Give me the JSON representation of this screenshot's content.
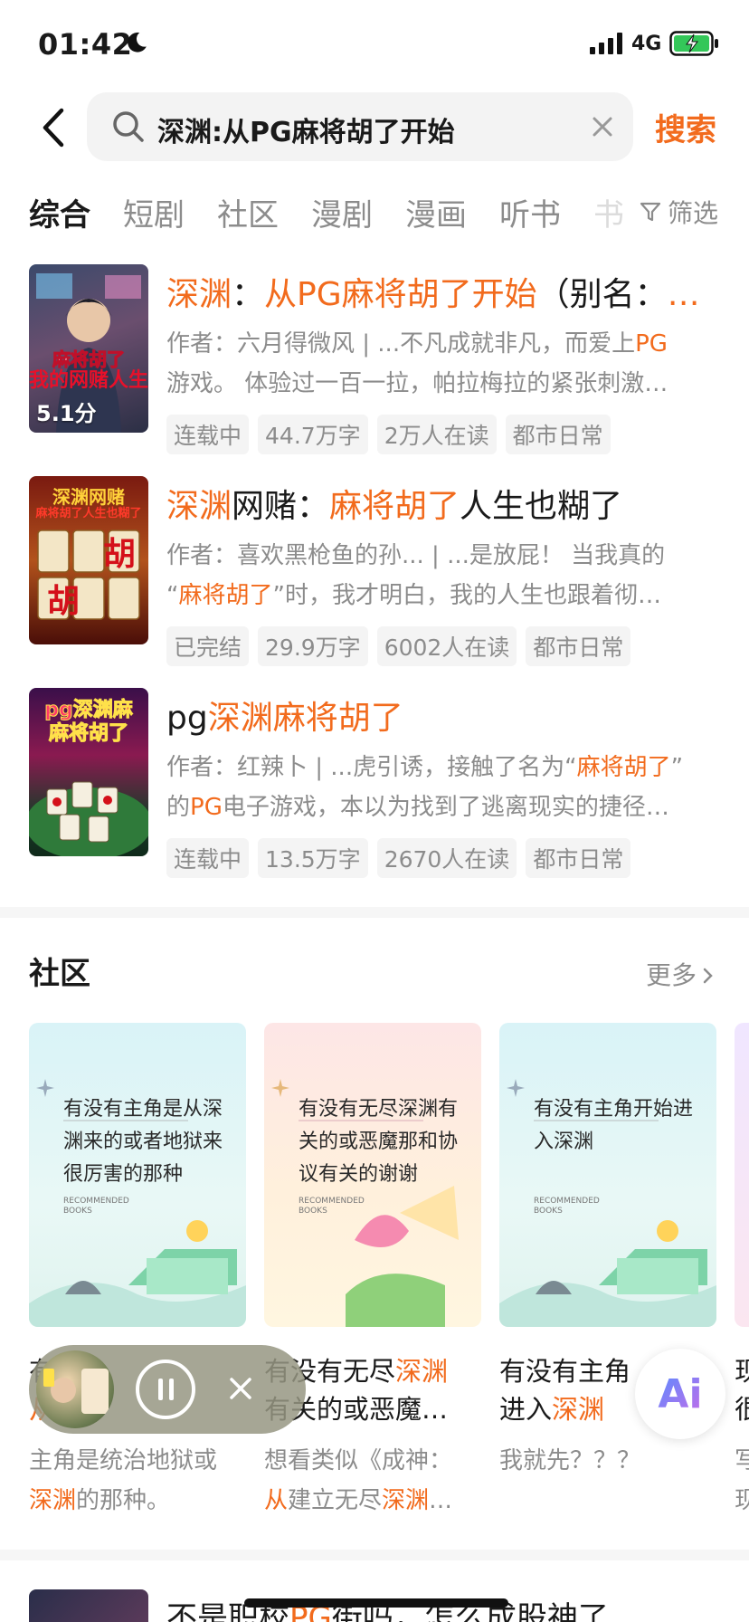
{
  "status_bar": {
    "time": "01:42",
    "network": "4G"
  },
  "search": {
    "query": "深渊:从PG麻将胡了开始",
    "button_label": "搜索"
  },
  "tabs": [
    "综合",
    "短剧",
    "社区",
    "漫剧",
    "漫画",
    "听书",
    "书"
  ],
  "filter_label": "筛选",
  "books": [
    {
      "title_parts": [
        {
          "text": "深渊",
          "hl": true
        },
        {
          "text": "：",
          "hl": false
        },
        {
          "text": "从PG麻将胡了开始",
          "hl": true
        },
        {
          "text": "（别名：",
          "hl": false
        },
        {
          "text": "…",
          "hl": true
        }
      ],
      "desc_lines": [
        [
          {
            "text": "作者：六月得微风 | ...不凡成就非凡，而爱上",
            "hl": false
          },
          {
            "text": "PG",
            "hl": true
          }
        ],
        [
          {
            "text": "游戏。 体验过一百一拉，帕拉梅拉的紧张刺激…",
            "hl": false
          }
        ]
      ],
      "tags": [
        "连载中",
        "44.7万字",
        "2万人在读",
        "都市日常"
      ],
      "cover_text": "麻将胡了\n我的网赌人生",
      "score": "5.1分"
    },
    {
      "title_parts": [
        {
          "text": "深渊",
          "hl": true
        },
        {
          "text": "网赌：",
          "hl": false
        },
        {
          "text": "麻将胡了",
          "hl": true
        },
        {
          "text": "人生也糊了",
          "hl": false
        }
      ],
      "desc_lines": [
        [
          {
            "text": "作者：喜欢黑枪鱼的孙... | ...是放屁！ 当我真的",
            "hl": false
          }
        ],
        [
          {
            "text": "“",
            "hl": false
          },
          {
            "text": "麻将胡了",
            "hl": true
          },
          {
            "text": "”时，我才明白，我的人生也跟着彻…",
            "hl": false
          }
        ]
      ],
      "tags": [
        "已完结",
        "29.9万字",
        "6002人在读",
        "都市日常"
      ],
      "cover_text": "深渊网赌\n麻将胡了人生也糊了",
      "score": ""
    },
    {
      "title_parts": [
        {
          "text": "pg",
          "hl": false
        },
        {
          "text": "深渊麻将胡了",
          "hl": true
        }
      ],
      "desc_lines": [
        [
          {
            "text": "作者：红辣卜 | ...虎引诱，接触了名为“",
            "hl": false
          },
          {
            "text": "麻将胡了",
            "hl": true
          },
          {
            "text": "”",
            "hl": false
          }
        ],
        [
          {
            "text": "的",
            "hl": false
          },
          {
            "text": "PG",
            "hl": true
          },
          {
            "text": "电子游戏，本以为找到了逃离现实的捷径…",
            "hl": false
          }
        ]
      ],
      "tags": [
        "连载中",
        "13.5万字",
        "2670人在读",
        "都市日常"
      ],
      "cover_text": "pg深渊麻\n麻将胡了",
      "score": ""
    }
  ],
  "community": {
    "title": "社区",
    "more_label": "更多",
    "cards": [
      {
        "image_text": "有没有主角是从深渊来的或者地狱来很厉害的那种",
        "rec_text": "RECOMMENDED\nBOOKS",
        "title_parts": [
          {
            "text": "有",
            "hl": false
          }
        ],
        "title_line2": [
          {
            "text": "从",
            "hl": true
          }
        ],
        "desc_parts": [
          {
            "text": "主角是统治地狱或",
            "hl": false
          }
        ],
        "desc_line2": [
          {
            "text": "深渊",
            "hl": true
          },
          {
            "text": "的那种。",
            "hl": false
          }
        ]
      },
      {
        "image_text": "有没有无尽深渊有关的或恶魔那和协议有关的谢谢",
        "rec_text": "RECOMMENDED\nBOOKS",
        "title_parts": [
          {
            "text": "有没有无尽",
            "hl": false
          },
          {
            "text": "深渊",
            "hl": true
          }
        ],
        "title_line2": [
          {
            "text": "有关的或恶魔…",
            "hl": false
          }
        ],
        "desc_parts": [
          {
            "text": "想看类似《成神：",
            "hl": false
          }
        ],
        "desc_line2": [
          {
            "text": "从",
            "hl": true
          },
          {
            "text": "建立无尽",
            "hl": false
          },
          {
            "text": "深渊",
            "hl": true
          },
          {
            "text": "…",
            "hl": false
          }
        ]
      },
      {
        "image_text": "有没有主角开始进入深渊",
        "rec_text": "RECOMMENDED\nBOOKS",
        "title_parts": [
          {
            "text": "有没有主角",
            "hl": false
          }
        ],
        "title_line2": [
          {
            "text": "进入",
            "hl": false
          },
          {
            "text": "深渊",
            "hl": true
          }
        ],
        "desc_parts": [
          {
            "text": "我就先？？？",
            "hl": false
          }
        ],
        "desc_line2": []
      }
    ],
    "fourth_partial": {
      "line1": "现",
      "line2": "很",
      "line3": "写",
      "line4": "现"
    }
  },
  "player": {
    "close_label": "×"
  },
  "ai_button": {
    "label": "Ai"
  },
  "next_result": {
    "title_parts": [
      {
        "text": "不是职校",
        "hl": false
      },
      {
        "text": "PG",
        "hl": true
      },
      {
        "text": "街吗，怎么成股神了",
        "hl": false
      }
    ]
  },
  "colors": {
    "accent": "#f26b1d",
    "muted": "#8c8c8c",
    "tag_bg": "#f4f4f4"
  },
  "icons": [
    "moon-icon",
    "signal-icon",
    "battery-charging-icon",
    "back-arrow-icon",
    "search-icon",
    "clear-icon",
    "filter-icon",
    "chevron-right-icon",
    "pause-icon",
    "close-icon"
  ]
}
